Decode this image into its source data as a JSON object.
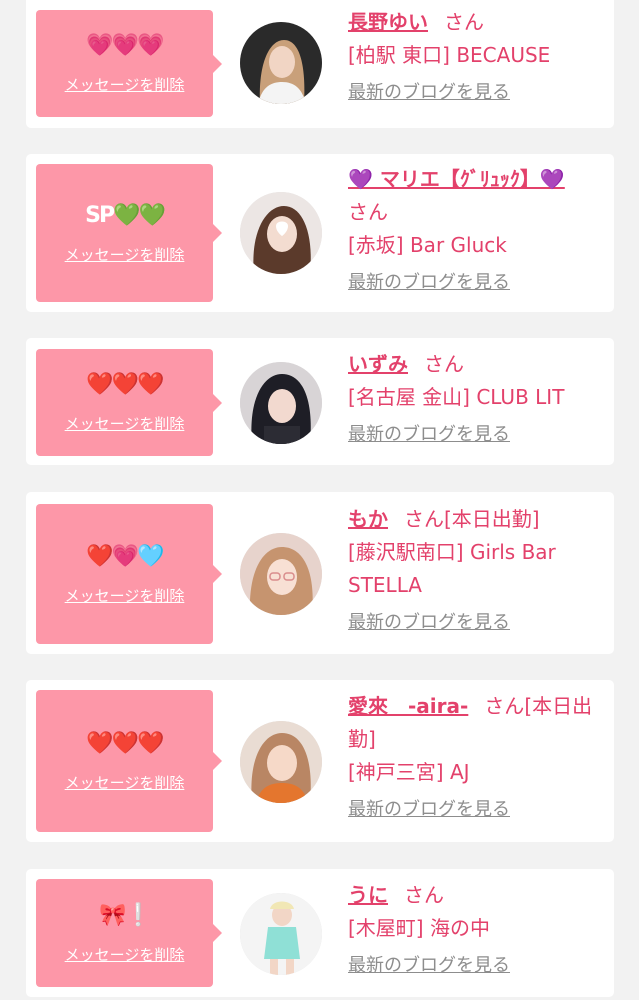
{
  "delete_label": "メッセージを削除",
  "blog_label": "最新のブログを見る",
  "san_label": "さん",
  "colors": {
    "accent": "#e3416b",
    "panel": "#fd97a8",
    "link_gray": "#8d8d8d"
  },
  "entries": [
    {
      "mark": "💗💗💗",
      "name": "長野ゆい",
      "status": "",
      "shop": "[柏駅 東口] BECAUSE"
    },
    {
      "mark": "SP💚💚",
      "name": "💜 マリエ【ｸﾞﾘｭｯｸ】💜",
      "status": "",
      "shop": "[赤坂] Bar Gluck"
    },
    {
      "mark": "❤️❤️❤️",
      "name": "いずみ",
      "status": "",
      "shop": "[名古屋 金山] CLUB LIT"
    },
    {
      "mark": "❤️💗🩵",
      "name": "もか",
      "status": "[本日出勤]",
      "shop": "[藤沢駅南口] Girls Bar STELLA"
    },
    {
      "mark": "❤️❤️❤️",
      "name": "愛來　-aira-",
      "status": "[本日出勤]",
      "shop": "[神戸三宮] AJ"
    },
    {
      "mark": "🎀❕",
      "name": "うに",
      "status": "",
      "shop": "[木屋町] 海の中"
    }
  ]
}
